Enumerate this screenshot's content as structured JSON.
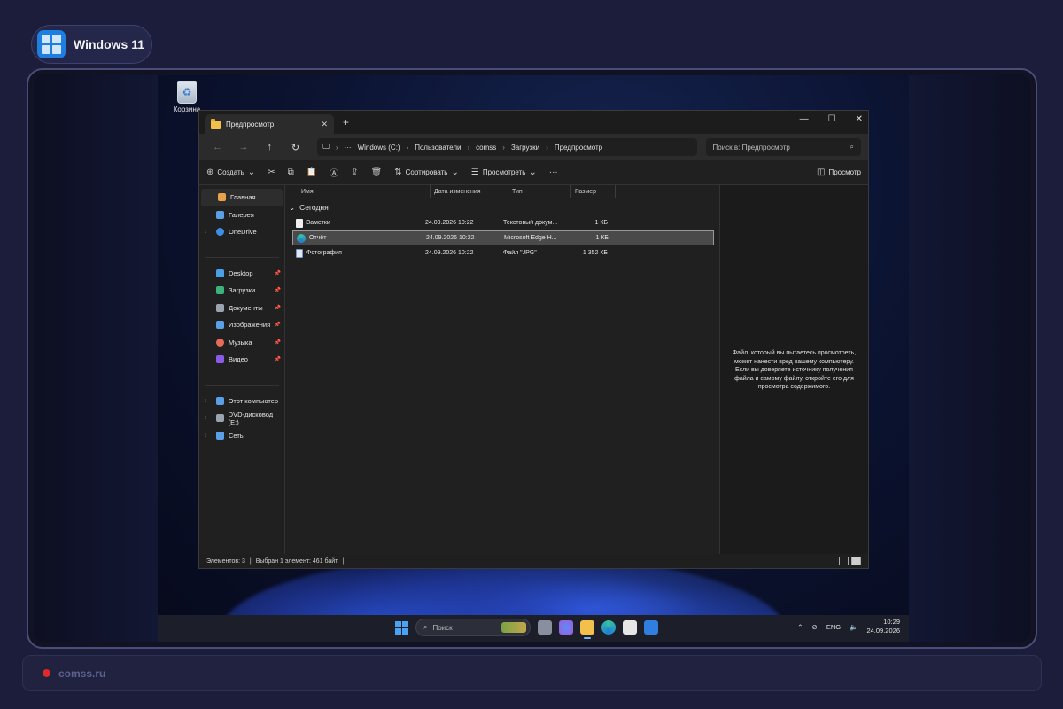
{
  "badge": {
    "title": "Windows 11"
  },
  "desktop": {
    "recycle_bin": "Корзина"
  },
  "explorer": {
    "tab_title": "Предпросмотр",
    "tab_close": "✕",
    "new_tab": "+",
    "window_controls": {
      "minimize": "—",
      "maximize": "☐",
      "close": "✕"
    },
    "nav": {
      "back": "←",
      "forward": "→",
      "up": "↑",
      "refresh": "↻"
    },
    "address": {
      "more": "···",
      "breadcrumb": [
        "Windows (C:)",
        "Пользователи",
        "comss",
        "Загрузки",
        "Предпросмотр"
      ]
    },
    "search_placeholder": "Поиск в: Предпросмотр",
    "toolbar": {
      "new": "Создать",
      "sort": "Сортировать",
      "view": "Просмотреть",
      "more": "···",
      "preview": "Просмотр"
    },
    "sidebar": {
      "top": [
        {
          "label": "Главная",
          "icon": "home-icon",
          "color": "#e8a34a"
        },
        {
          "label": "Галерея",
          "icon": "gallery-icon",
          "color": "#5aa0e6"
        },
        {
          "label": "OneDrive",
          "icon": "cloud-icon",
          "color": "#3f8ee6"
        }
      ],
      "pinned": [
        {
          "label": "Desktop",
          "icon": "desktop-icon",
          "color": "#4aa0e8"
        },
        {
          "label": "Загрузки",
          "icon": "download-icon",
          "color": "#3bb37a"
        },
        {
          "label": "Документы",
          "icon": "documents-icon",
          "color": "#9aa4b0"
        },
        {
          "label": "Изображения",
          "icon": "pictures-icon",
          "color": "#5aa0e6"
        },
        {
          "label": "Музыка",
          "icon": "music-icon",
          "color": "#e86b5a"
        },
        {
          "label": "Видео",
          "icon": "video-icon",
          "color": "#8b5ae6"
        }
      ],
      "bottom": [
        {
          "label": "Этот компьютер",
          "icon": "computer-icon",
          "color": "#5aa0e6"
        },
        {
          "label": "DVD-дисковод (E:)",
          "icon": "dvd-icon",
          "color": "#9aa4b0"
        },
        {
          "label": "Сеть",
          "icon": "network-icon",
          "color": "#5aa0e6"
        }
      ]
    },
    "columns": [
      "Имя",
      "Дата изменения",
      "Тип",
      "Размер"
    ],
    "group": "Сегодня",
    "files": [
      {
        "name": "Заметки",
        "date": "24.09.2026 10:22",
        "type": "Текстовый докум...",
        "size": "1 КБ",
        "icon": "text-file-icon"
      },
      {
        "name": "Отчёт",
        "date": "24.09.2026 10:22",
        "type": "Microsoft Edge H...",
        "size": "1 КБ",
        "icon": "edge-html-icon"
      },
      {
        "name": "Фотография",
        "date": "24.09.2026 10:22",
        "type": "Файл \"JPG\"",
        "size": "1 352 КБ",
        "icon": "image-file-icon"
      }
    ],
    "preview_message": "Файл, который вы пытаетесь просмотреть, может нанести вред вашему компьютеру. Если вы доверяете источнику получения файла и самому файлу, откройте его для просмотра содержимого.",
    "status": {
      "items": "Элементов: 3",
      "sep": "|",
      "selected": "Выбран 1 элемент: 461 байт",
      "sep2": "|"
    }
  },
  "taskbar": {
    "search_placeholder": "Поиск",
    "lang": "ENG",
    "time": "10:29",
    "date": "24.09.2026"
  },
  "footer": {
    "site": "comss.ru"
  },
  "colors": {
    "accent": "#1e7fe0",
    "status_dot": "#e02a2a"
  }
}
